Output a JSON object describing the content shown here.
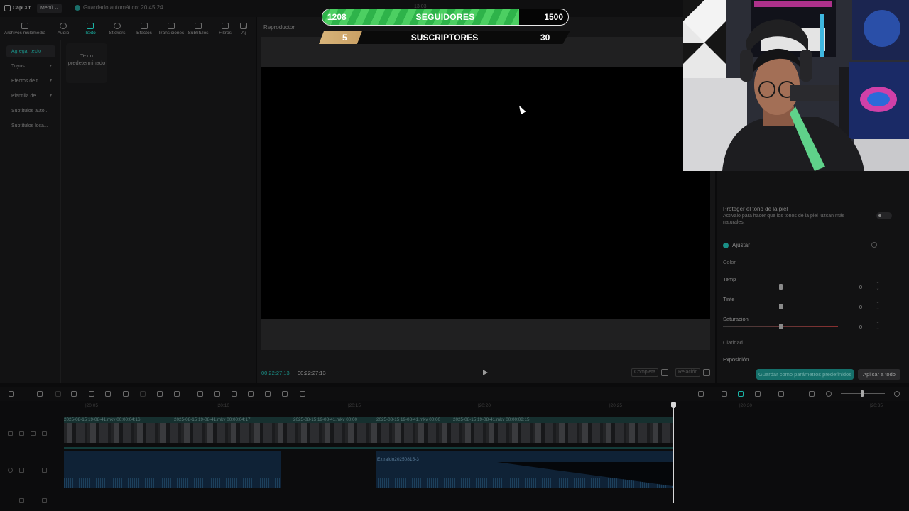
{
  "app": {
    "logo": "CapCut",
    "menu": "Menú",
    "autosave": "Guardado automático: 20:45:24",
    "project": "13:03"
  },
  "left_tabs": [
    {
      "label": "Archivos multimedia",
      "icon": "media-icon"
    },
    {
      "label": "Audio",
      "icon": "audio-icon"
    },
    {
      "label": "Texto",
      "icon": "text-icon"
    },
    {
      "label": "Stickers",
      "icon": "sticker-icon"
    },
    {
      "label": "Efectos",
      "icon": "effects-icon"
    },
    {
      "label": "Transiciones",
      "icon": "transitions-icon"
    },
    {
      "label": "Subtítulos",
      "icon": "subtitles-icon"
    },
    {
      "label": "Filtros",
      "icon": "filters-icon"
    },
    {
      "label": "Aj",
      "icon": "adjust-icon"
    }
  ],
  "subnav": [
    {
      "label": "Agregar texto",
      "chevron": false
    },
    {
      "label": "Tuyos",
      "chevron": true
    },
    {
      "label": "Efectos de t...",
      "chevron": true
    },
    {
      "label": "Plantilla de ...",
      "chevron": true
    },
    {
      "label": "Subtítulos auto...",
      "chevron": false
    },
    {
      "label": "Subtítulos loca...",
      "chevron": false
    }
  ],
  "text_card": "Texto predeterminado",
  "player": {
    "title": "Reproductor",
    "time_current": "00:22:27:13",
    "time_total": "00:22:27:13",
    "mode_label": "Completa",
    "ratio_label": "Relación"
  },
  "overlay": {
    "followers": {
      "current": "1208",
      "label": "SEGUIDORES",
      "goal": "1500",
      "progress": 0.8
    },
    "subscribers": {
      "current": "5",
      "label": "SUSCRIPTORES",
      "goal": "30",
      "progress": 0.17
    }
  },
  "right_panel": {
    "skin_title": "Proteger el tono de la piel",
    "skin_desc": "Actívalo para hacer que los tonos de la piel luzcan más naturales.",
    "adjust_title": "Ajustar",
    "color_section": "Color",
    "sliders": [
      {
        "label": "Temp",
        "value": "0"
      },
      {
        "label": "Tinte",
        "value": "0"
      },
      {
        "label": "Saturación",
        "value": "0"
      }
    ],
    "clarity_section": "Claridad",
    "exposure_label": "Exposición",
    "save_default": "Guardar como parámetros predefinidos",
    "apply_all": "Aplicar a todo"
  },
  "timeline": {
    "ruler": [
      "|20:05",
      "|20:10",
      "|20:15",
      "|20:20",
      "|20:25",
      "|20:30",
      "|20:35"
    ],
    "video_clips": [
      "2025-08-15 19-08-41.mkv  00:00:04:16",
      "2025-08-15 19-08-41.mkv  00:00:04:17",
      "2025-08-15 19-08-41.mkv  00:00",
      "2025-08-15 19-08-41.mkv  00:00",
      "2025-08-15 19-08-41.mkv  00:00:08:15"
    ],
    "audio_clip": "Extraído20250815-3"
  },
  "colors": {
    "accent": "#1ab3a6",
    "followers_bar": "#3fc456",
    "subscribers_bar": "#d4ad70"
  }
}
